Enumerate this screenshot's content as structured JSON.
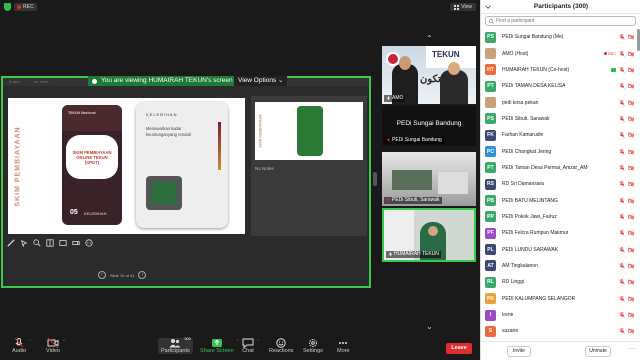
{
  "meeting": {
    "rec_label": "REC",
    "view_label": "View",
    "share_banner": "You are viewing HUMAIRAH TEKUN's screen",
    "view_options": "View Options",
    "slide_counter": "Slide 10 of 41",
    "notes_label": "No Notes",
    "slide": {
      "vertical_title": "SKIM PEMBIAYAAN",
      "brand": "TEKUN Nasional",
      "card_center": "SKIM PEMBIAYAAN ONLINE TEKUN (SPOT)",
      "card_number": "05",
      "card_number_label": "KELEBIHAN",
      "right_title": "KELEBIHAN",
      "right_body": "Menawarkan kadar keuntunganyang rendah"
    },
    "tiles": [
      {
        "name": "AMO"
      },
      {
        "name": "PEDi Sungai Bandung"
      },
      {
        "name": "PEDi Sibuti, Sarawak"
      },
      {
        "name": "HUMAIRAH TEKUN"
      }
    ],
    "amo_banner": "TEKUN",
    "amo_arabic": "تكون"
  },
  "toolbar": {
    "audio": "Audio",
    "video": "Video",
    "participants": "Participants",
    "participants_count": "300",
    "share": "Share Screen",
    "chat": "Chat",
    "reactions": "Reactions",
    "settings": "Settings",
    "more": "More",
    "leave": "Leave"
  },
  "panel": {
    "title": "Participants (300)",
    "search_placeholder": "Find a participant",
    "invite": "Invite",
    "unmute": "Unmute",
    "participants": [
      {
        "initials": "PS",
        "name": "PEDi Sungai Bandung (Me)",
        "color": "#3aa96a",
        "rec": false,
        "share": false
      },
      {
        "initials": "",
        "name": "AMO (Host)",
        "color": "#c9a27d",
        "rec": true,
        "share": false
      },
      {
        "initials": "HT",
        "name": "HUMAIRAH TEKUN (Co-host)",
        "color": "#ee6a3a",
        "rec": false,
        "share": true
      },
      {
        "initials": "PT",
        "name": "PEDi TAMAN DESA KELISA",
        "color": "#3aa96a",
        "rec": false,
        "share": false
      },
      {
        "initials": "",
        "name": "pedi kosa pekan",
        "color": "#c9a27d",
        "rec": false,
        "share": false
      },
      {
        "initials": "PS",
        "name": "PEDi Sibuti, Sarawak",
        "color": "#3aa96a",
        "rec": false,
        "share": false
      },
      {
        "initials": "FK",
        "name": "Farhan Kamarudin",
        "color": "#3b4a70",
        "rec": false,
        "share": false
      },
      {
        "initials": "PC",
        "name": "PEDi Changkat Jering",
        "color": "#2f93d6",
        "rec": false,
        "share": false
      },
      {
        "initials": "PT",
        "name": "PEDi Taman Desa Permai_Amzar_AM",
        "color": "#3aa96a",
        "rec": false,
        "share": false
      },
      {
        "initials": "RS",
        "name": "RD Sri Damansara",
        "color": "#3b4a70",
        "rec": false,
        "share": false
      },
      {
        "initials": "PB",
        "name": "PEDi BATU MELINTANG",
        "color": "#3aa96a",
        "rec": false,
        "share": false
      },
      {
        "initials": "PP",
        "name": "PEDi Pokok Jawi_Fairuz",
        "color": "#3aa96a",
        "rec": false,
        "share": false
      },
      {
        "initials": "PF",
        "name": "PEDi Felcra Rumpun Makmur",
        "color": "#9b4cc2",
        "rec": false,
        "share": false
      },
      {
        "initials": "PL",
        "name": "PEDi LUNDU SARAWAK",
        "color": "#3b4a70",
        "rec": false,
        "share": false
      },
      {
        "initials": "AT",
        "name": "AM Tingkalanon",
        "color": "#3b4a70",
        "rec": false,
        "share": false
      },
      {
        "initials": "RL",
        "name": "RD Linggi",
        "color": "#3aa96a",
        "rec": false,
        "share": false
      },
      {
        "initials": "PK",
        "name": "PEDI KALUMPANG SELANGOR",
        "color": "#e8a33a",
        "rec": false,
        "share": false
      },
      {
        "initials": "I",
        "name": "Irene",
        "color": "#9b4cc2",
        "rec": false,
        "share": false
      },
      {
        "initials": "S",
        "name": "suzane",
        "color": "#ee6a3a",
        "rec": false,
        "share": false
      }
    ]
  }
}
